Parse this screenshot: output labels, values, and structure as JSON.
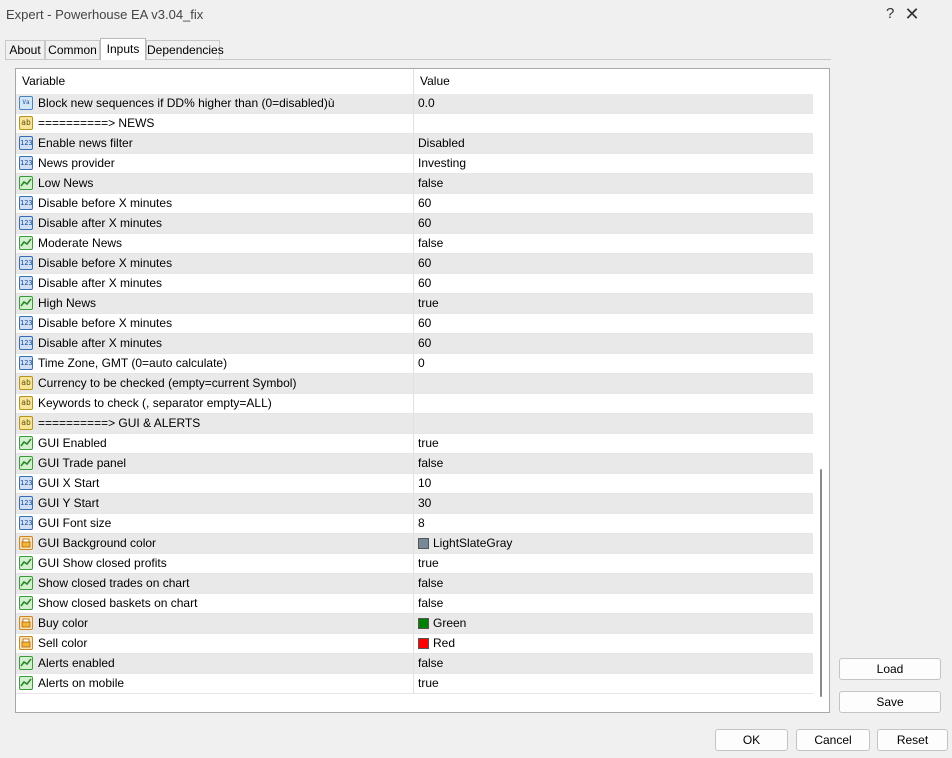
{
  "window": {
    "title": "Expert - Powerhouse EA v3.04_fix",
    "help_glyph": "?",
    "close_glyph": "✕"
  },
  "tabs": [
    {
      "label": "About"
    },
    {
      "label": "Common"
    },
    {
      "label": "Inputs",
      "active": true
    },
    {
      "label": "Dependencies"
    }
  ],
  "grid": {
    "headers": {
      "variable": "Variable",
      "value": "Value"
    },
    "rows": [
      {
        "type": "double",
        "icon": "Va",
        "variable": "Block new sequences if DD% higher than (0=disabled)ù",
        "value": "0.0"
      },
      {
        "type": "string",
        "icon": "ab",
        "variable": "==========> NEWS",
        "value": ""
      },
      {
        "type": "int",
        "icon": "123",
        "variable": "Enable news filter",
        "value": "Disabled"
      },
      {
        "type": "int",
        "icon": "123",
        "variable": "News provider",
        "value": "Investing"
      },
      {
        "type": "bool",
        "icon": "",
        "variable": "Low News",
        "value": "false"
      },
      {
        "type": "int",
        "icon": "123",
        "variable": "Disable before X minutes",
        "value": "60"
      },
      {
        "type": "int",
        "icon": "123",
        "variable": "Disable after X minutes",
        "value": "60"
      },
      {
        "type": "bool",
        "icon": "",
        "variable": "Moderate News",
        "value": "false"
      },
      {
        "type": "int",
        "icon": "123",
        "variable": "Disable before X minutes",
        "value": "60"
      },
      {
        "type": "int",
        "icon": "123",
        "variable": "Disable after X minutes",
        "value": "60"
      },
      {
        "type": "bool",
        "icon": "",
        "variable": "High News",
        "value": "true"
      },
      {
        "type": "int",
        "icon": "123",
        "variable": "Disable before X minutes",
        "value": "60"
      },
      {
        "type": "int",
        "icon": "123",
        "variable": "Disable after X minutes",
        "value": "60"
      },
      {
        "type": "int",
        "icon": "123",
        "variable": "Time Zone, GMT (0=auto calculate)",
        "value": "0"
      },
      {
        "type": "string",
        "icon": "ab",
        "variable": "Currency to be checked (empty=current Symbol)",
        "value": ""
      },
      {
        "type": "string",
        "icon": "ab",
        "variable": "Keywords to check (, separator empty=ALL)",
        "value": ""
      },
      {
        "type": "string",
        "icon": "ab",
        "variable": "==========> GUI & ALERTS",
        "value": ""
      },
      {
        "type": "bool",
        "icon": "",
        "variable": "GUI Enabled",
        "value": "true"
      },
      {
        "type": "bool",
        "icon": "",
        "variable": "GUI Trade panel",
        "value": "false"
      },
      {
        "type": "int",
        "icon": "123",
        "variable": "GUI X Start",
        "value": "10"
      },
      {
        "type": "int",
        "icon": "123",
        "variable": "GUI Y Start",
        "value": "30"
      },
      {
        "type": "int",
        "icon": "123",
        "variable": "GUI Font size",
        "value": "8"
      },
      {
        "type": "color",
        "icon": "",
        "variable": "GUI Background color",
        "value": "LightSlateGray",
        "swatch": "#778899"
      },
      {
        "type": "bool",
        "icon": "",
        "variable": "GUI Show closed profits",
        "value": "true"
      },
      {
        "type": "bool",
        "icon": "",
        "variable": "Show closed trades on chart",
        "value": "false"
      },
      {
        "type": "bool",
        "icon": "",
        "variable": "Show closed baskets on chart",
        "value": "false"
      },
      {
        "type": "color",
        "icon": "",
        "variable": "Buy color",
        "value": "Green",
        "swatch": "#008000"
      },
      {
        "type": "color",
        "icon": "",
        "variable": "Sell color",
        "value": "Red",
        "swatch": "#ff0000"
      },
      {
        "type": "bool",
        "icon": "",
        "variable": "Alerts enabled",
        "value": "false"
      },
      {
        "type": "bool",
        "icon": "",
        "variable": "Alerts on mobile",
        "value": "true"
      }
    ]
  },
  "side_buttons": {
    "load": "Load",
    "save": "Save"
  },
  "footer_buttons": {
    "ok": "OK",
    "cancel": "Cancel",
    "reset": "Reset"
  }
}
